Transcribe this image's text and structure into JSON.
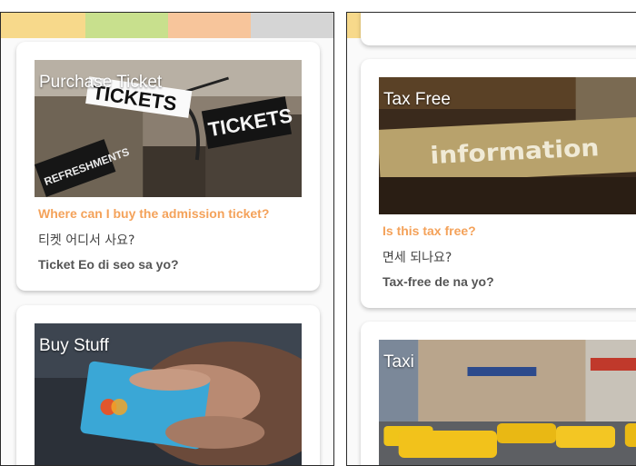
{
  "palette": [
    "#f7d98b",
    "#c8e08d",
    "#f7c59b",
    "#d5d5d5"
  ],
  "left": {
    "cards": [
      {
        "title": "Purchase Ticket",
        "question": "Where can I buy the admission ticket?",
        "korean": "티켓 어디서 사요?",
        "romanized": "Ticket Eo di seo sa yo?",
        "sign_text_1": "TICKETS",
        "sign_text_2": "TICKETS",
        "sign_text_3": "REFRESHMENTS"
      },
      {
        "title": "Buy Stuff"
      }
    ]
  },
  "right": {
    "cards": [
      {
        "title": "Tax Free",
        "question": "Is this tax free?",
        "korean": "면세 되나요?",
        "romanized": "Tax-free de na yo?",
        "sign_text_1": "information"
      },
      {
        "title": "Taxi"
      }
    ]
  }
}
